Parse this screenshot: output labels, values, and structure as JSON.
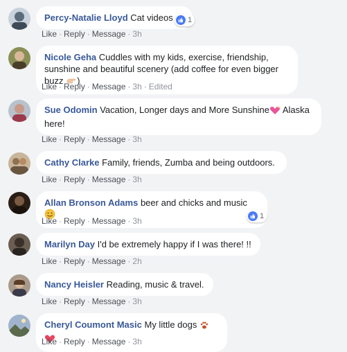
{
  "actions": {
    "like": "Like",
    "reply": "Reply",
    "message": "Message",
    "dot": "·"
  },
  "comments": [
    {
      "author": "Percy-Natalie Lloyd",
      "text": "Cat videos",
      "time": "3h",
      "edited": "",
      "reactions": "1",
      "avatar_color": "#5b6b7a"
    },
    {
      "author": "Nicole Geha",
      "text": "Cuddles with my kids, exercise, friendship, sunshine and beautiful scenery (add coffee for even bigger buzz",
      "text_end": ")",
      "time": "3h",
      "edited": "Edited",
      "avatar_color": "#6d6a3e"
    },
    {
      "author": "Sue Odomin",
      "text": "Vacation, Longer days and More Sunshine",
      "text_end": " Alaska here!",
      "time": "3h",
      "edited": "",
      "avatar_color": "#8a5a5a"
    },
    {
      "author": "Cathy Clarke",
      "text": "Family, friends, Zumba and being outdoors.",
      "time": "3h",
      "edited": "",
      "avatar_color": "#8f7152"
    },
    {
      "author": "Allan Bronson Adams",
      "text": "beer and chicks and music",
      "time": "3h",
      "edited": "",
      "reactions": "1",
      "avatar_color": "#3d2a1e"
    },
    {
      "author": "Marilyn Day",
      "text": "I'd be extremely happy if I was there! !!",
      "time": "2h",
      "edited": "",
      "avatar_color": "#4a4038"
    },
    {
      "author": "Nancy Heisler",
      "text": "Reading, music & travel.",
      "time": "3h",
      "edited": "",
      "avatar_color": "#5a4a3a"
    },
    {
      "author": "Cheryl Coumont Masic",
      "text": "My little dogs",
      "time": "3h",
      "edited": "",
      "avatar_color": "#6a7f9a"
    }
  ]
}
